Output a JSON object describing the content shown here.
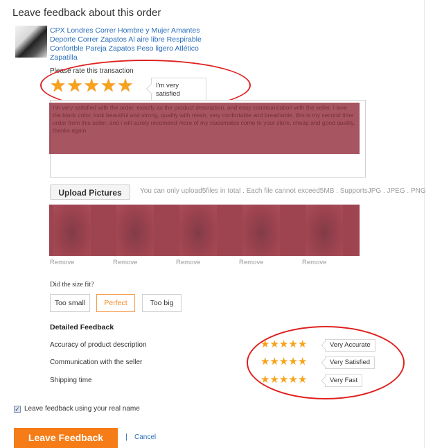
{
  "page": {
    "title": "Leave feedback about this order"
  },
  "product": {
    "link_text": "CPX Londres Correr Hombre y Mujer Amantes Deporte Correr Zapatos Al aire libre Respirable Confortble Pareja Zapatos Peso ligero Atlético Zapatilla",
    "thumbnail_icon": "shoe-thumbnail"
  },
  "rating": {
    "label": "Please rate this transaction",
    "stars": 5,
    "tooltip": "I'm very satisfied",
    "star_color": "#f7a21a"
  },
  "review": {
    "text": "I'm very satisfied with the order, exactly as the product description, and easy communication with the seller. I love the black color, look beautiful and strong, quality with mesh, very confortable and breathable, this is my second time order from this seller, and i will surely recomend more of my classmates come to your store, cheap and good quality, thanks again"
  },
  "upload": {
    "button_label": "Upload Pictures",
    "note": "You can only upload5files in total . Each file cannot exceed5MB . SupportsJPG . JPEG . PNG",
    "remove_labels": [
      "Remove",
      "Remove",
      "Remove",
      "Remove",
      "Remove"
    ]
  },
  "size_fit": {
    "question": "Did the size fit?",
    "options": [
      "Too small",
      "Perfect",
      "Too big"
    ],
    "selected": "Perfect"
  },
  "detailed_feedback": {
    "title": "Detailed Feedback",
    "rows": [
      {
        "label": "Accuracy of product description",
        "stars": 5,
        "tooltip": "Very Accurate"
      },
      {
        "label": "Communication with the seller",
        "stars": 5,
        "tooltip": "Very Satisfied"
      },
      {
        "label": "Shipping time",
        "stars": 5,
        "tooltip": "Very Fast"
      }
    ]
  },
  "real_name": {
    "checked": true,
    "label": "Leave feedback using your real name"
  },
  "actions": {
    "submit_label": "Leave Feedback",
    "separator": "|",
    "cancel_label": "Cancel",
    "accent_color": "#f57c16",
    "link_color": "#2a6ebb"
  },
  "annotations": {
    "highlight_color": "#e02020"
  }
}
